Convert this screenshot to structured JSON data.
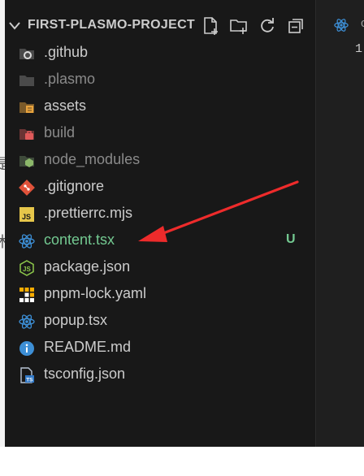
{
  "explorer": {
    "project_title": "FIRST-PLASMO-PROJECT",
    "actions": [
      "new-file",
      "new-folder",
      "refresh",
      "collapse-all"
    ]
  },
  "tree": {
    "items": [
      {
        "label": ".github",
        "kind": "folder",
        "icon": "github-folder-icon",
        "dim": false
      },
      {
        "label": ".plasmo",
        "kind": "folder",
        "icon": "folder-icon",
        "dim": true
      },
      {
        "label": "assets",
        "kind": "folder",
        "icon": "assets-folder-icon",
        "dim": false
      },
      {
        "label": "build",
        "kind": "folder",
        "icon": "build-folder-icon",
        "dim": true
      },
      {
        "label": "node_modules",
        "kind": "folder",
        "icon": "node-folder-icon",
        "dim": true
      },
      {
        "label": ".gitignore",
        "kind": "file",
        "icon": "git-icon",
        "dim": false
      },
      {
        "label": ".prettierrc.mjs",
        "kind": "file",
        "icon": "js-icon",
        "dim": false
      },
      {
        "label": "content.tsx",
        "kind": "file",
        "icon": "react-icon",
        "dim": false,
        "status": "U"
      },
      {
        "label": "package.json",
        "kind": "file",
        "icon": "nodejs-icon",
        "dim": false
      },
      {
        "label": "pnpm-lock.yaml",
        "kind": "file",
        "icon": "pnpm-icon",
        "dim": false
      },
      {
        "label": "popup.tsx",
        "kind": "file",
        "icon": "react-icon",
        "dim": false
      },
      {
        "label": "README.md",
        "kind": "file",
        "icon": "info-icon",
        "dim": false
      },
      {
        "label": "tsconfig.json",
        "kind": "file",
        "icon": "tsconfig-icon",
        "dim": false
      }
    ]
  },
  "editor": {
    "line_number": "1",
    "tab_label": "c"
  },
  "colors": {
    "sidebar_bg": "#181818",
    "editor_bg": "#1f1f1f",
    "untracked": "#73c991",
    "react": "#3d8fd6",
    "annotation_arrow": "#ee2b2b"
  }
}
